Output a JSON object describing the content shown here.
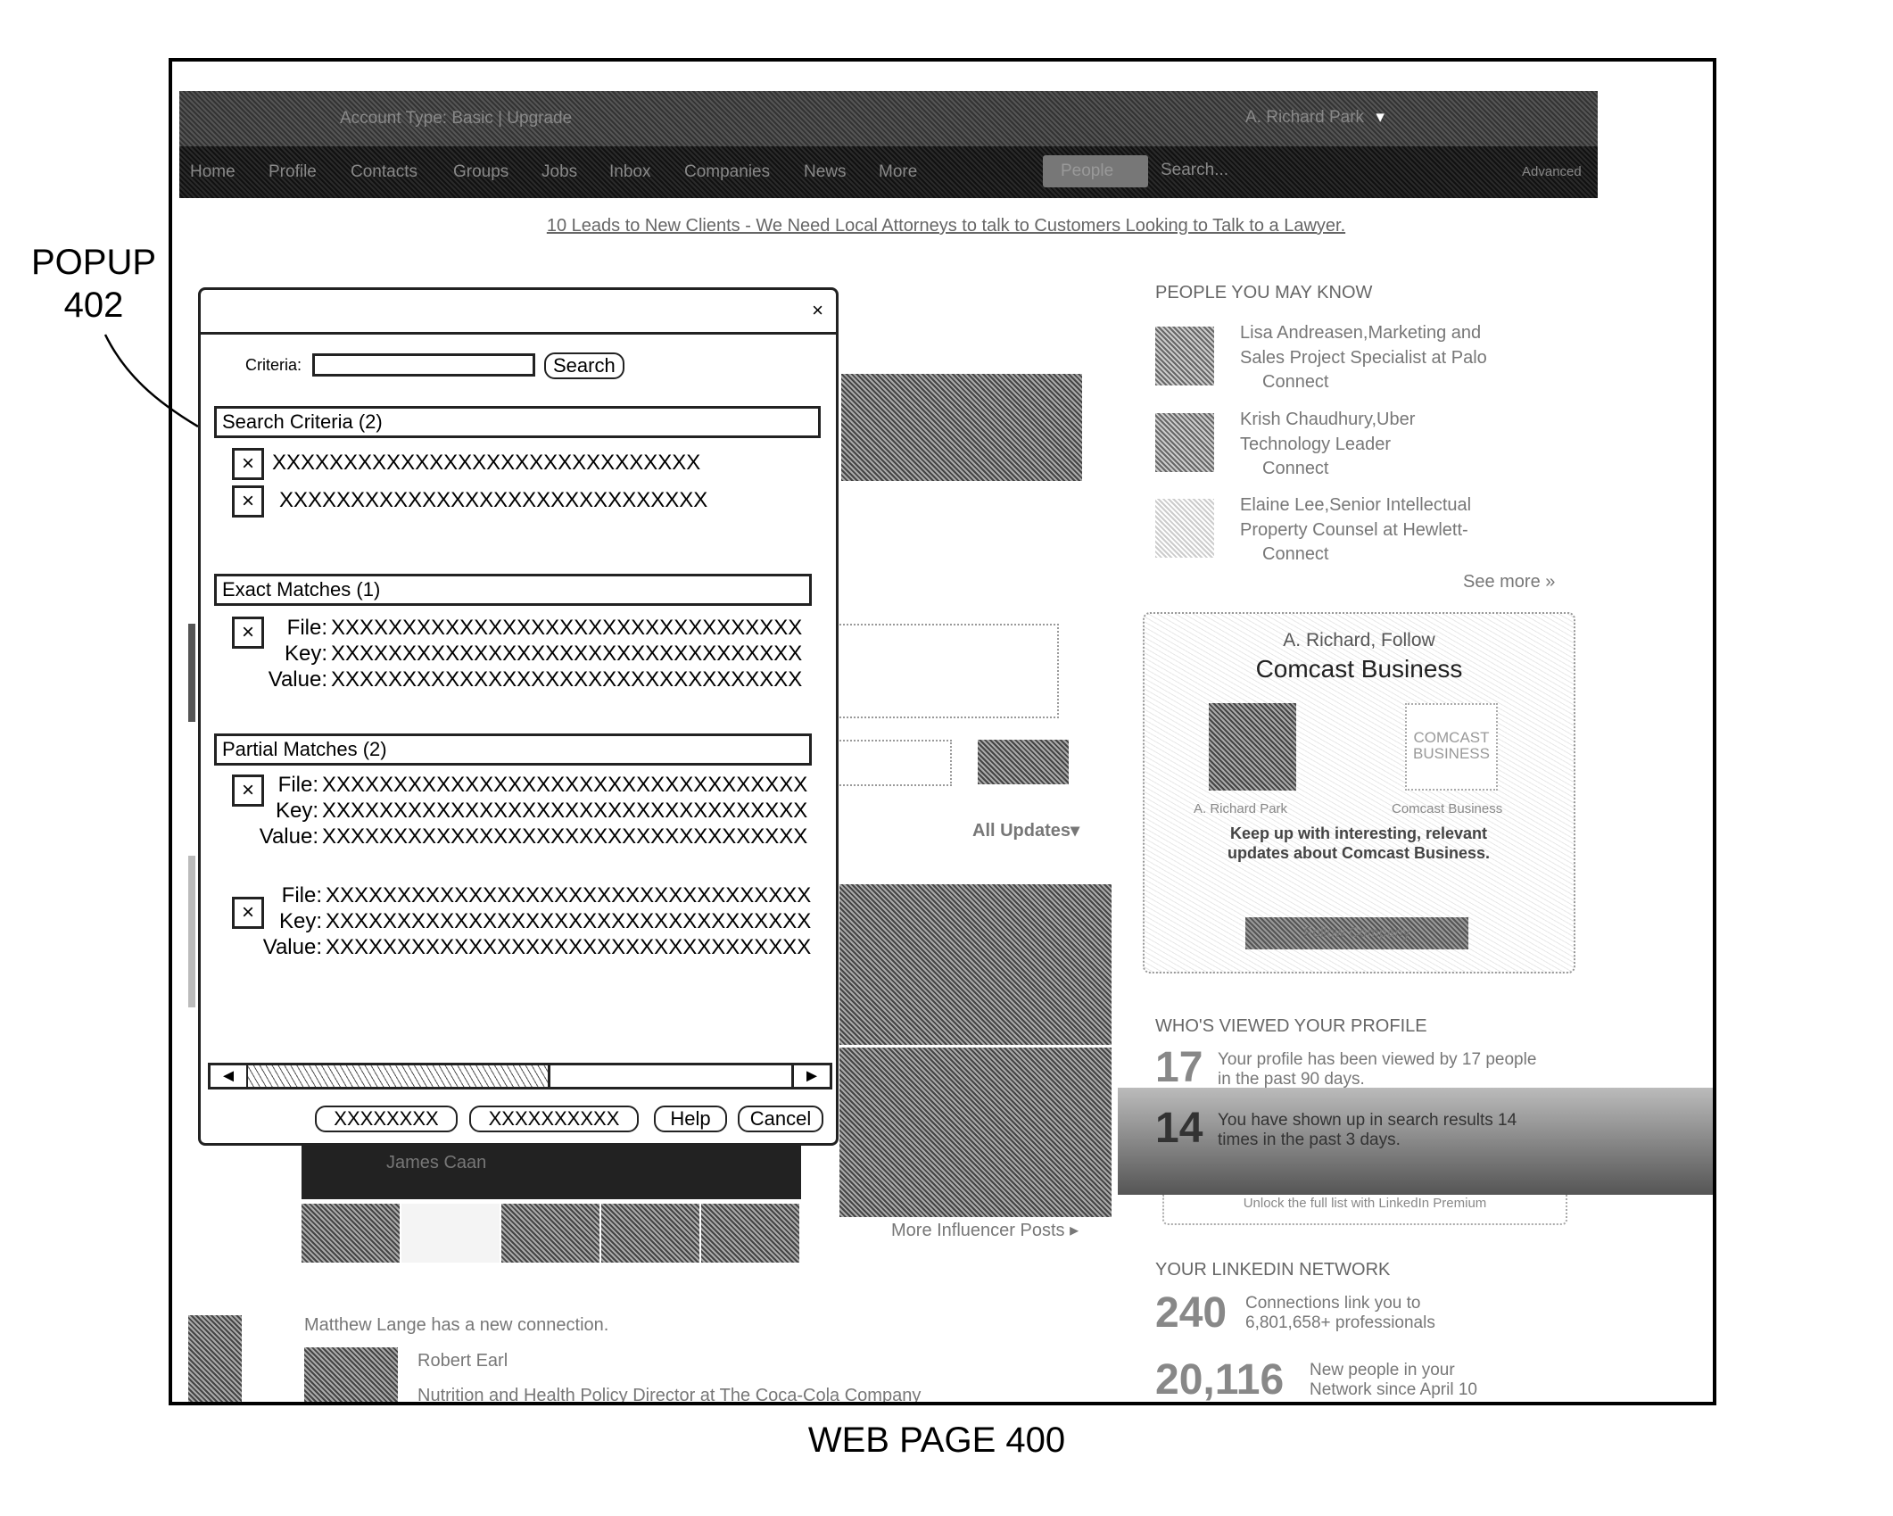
{
  "figure": {
    "popup_callout": "POPUP\n402",
    "popup_callout_line1": "POPUP",
    "popup_callout_line2": "402",
    "caption": "WEB PAGE 400"
  },
  "header": {
    "account_text": "Account Type: Basic | Upgrade",
    "user_menu": "A. Richard Park",
    "nav_items": [
      "Home",
      "Profile",
      "Contacts",
      "Groups",
      "Jobs",
      "Inbox",
      "Companies",
      "News",
      "More"
    ],
    "search_scope": "People",
    "search_placeholder": "Search...",
    "advanced_link": "Advanced"
  },
  "ad": {
    "text": "10 Leads to New Clients - We Need Local Attorneys to talk to Customers Looking to Talk to a Lawyer."
  },
  "popup": {
    "close_label": "×",
    "criteria_label": "Criteria:",
    "criteria_value": "",
    "search_button": "Search",
    "sections": {
      "search_criteria": {
        "title": "Search Criteria (2)",
        "items": [
          "XXXXXXXXXXXXXXXXXXXXXXXXXXXXXX",
          "XXXXXXXXXXXXXXXXXXXXXXXXXXXXXX"
        ]
      },
      "exact_matches": {
        "title": "Exact Matches (1)",
        "items": [
          {
            "file": "XXXXXXXXXXXXXXXXXXXXXXXXXXXXXXXXX",
            "key": "XXXXXXXXXXXXXXXXXXXXXXXXXXXXXXXXX",
            "value": "XXXXXXXXXXXXXXXXXXXXXXXXXXXXXXXXX"
          }
        ]
      },
      "partial_matches": {
        "title": "Partial Matches (2)",
        "items": [
          {
            "file": "XXXXXXXXXXXXXXXXXXXXXXXXXXXXXXXXXX",
            "key": "XXXXXXXXXXXXXXXXXXXXXXXXXXXXXXXXXX",
            "value": "XXXXXXXXXXXXXXXXXXXXXXXXXXXXXXXXXX"
          },
          {
            "file": "XXXXXXXXXXXXXXXXXXXXXXXXXXXXXXXXXX",
            "key": "XXXXXXXXXXXXXXXXXXXXXXXXXXXXXXXXXX",
            "value": "XXXXXXXXXXXXXXXXXXXXXXXXXXXXXXXXXX"
          }
        ]
      }
    },
    "labels": {
      "file": "File:",
      "key": "Key:",
      "value": "Value:"
    },
    "remove_icon": "×",
    "scroll_left": "◄",
    "scroll_right": "►",
    "scroll_position": 0.55,
    "footer_buttons": [
      "XXXXXXXX",
      "XXXXXXXXXX",
      "Help",
      "Cancel"
    ]
  },
  "feed": {
    "all_updates": "All Updates",
    "all_updates_caret": "▾",
    "influencer_name": "James Caan",
    "more_influencer": "More Influencer Posts ▸",
    "update_text": "Matthew Lange has a new connection.",
    "connection_name": "Robert Earl",
    "connection_title": "Nutrition and Health Policy Director at The Coca-Cola Company"
  },
  "sidebar": {
    "pymk_title": "PEOPLE YOU MAY KNOW",
    "people": [
      {
        "line1": "Lisa Andreasen,Marketing and",
        "line2": "Sales Project Specialist at Palo",
        "action": "Connect"
      },
      {
        "line1": "Krish Chaudhury,Uber",
        "line2": "Technology Leader",
        "action": "Connect"
      },
      {
        "line1": "Elaine Lee,Senior Intellectual",
        "line2": "Property Counsel at Hewlett-",
        "action": "Connect"
      }
    ],
    "see_more": "See more »",
    "follow": {
      "greeting": "A. Richard, Follow",
      "greeting_name": "A. Richard",
      "company": "Comcast Business",
      "person_caption": "A. Richard Park",
      "company_caption": "Comcast Business",
      "logo_line1": "COMCAST",
      "logo_line2": "BUSINESS",
      "pitch": "Keep up with interesting, relevant updates about Comcast Business.",
      "button": "Follow Company"
    },
    "profile_views": {
      "title": "WHO'S VIEWED YOUR PROFILE",
      "stats": [
        {
          "number": "17",
          "text": "Your profile has been viewed by 17 people in the past 90 days."
        },
        {
          "number": "14",
          "text": "You have shown up in search results 14 times in the past 3 days."
        }
      ],
      "unlock": "Unlock the full list with LinkedIn Premium"
    },
    "network": {
      "title": "YOUR LINKEDIN NETWORK",
      "stats": [
        {
          "number": "240",
          "text": "Connections link you to 6,801,658+ professionals"
        },
        {
          "number": "20,116",
          "text": "New people in your Network since April 10"
        }
      ]
    }
  }
}
